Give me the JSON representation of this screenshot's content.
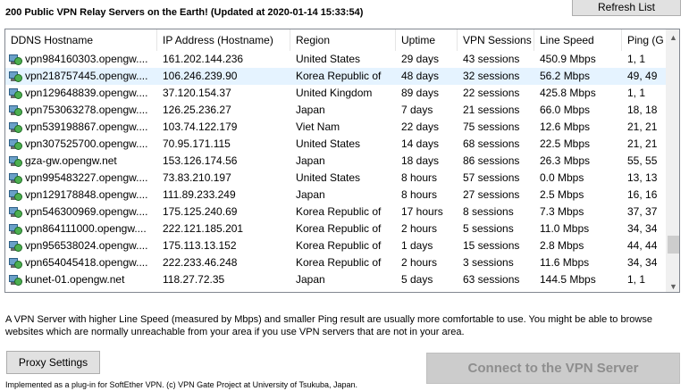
{
  "header": {
    "title": "200 Public VPN Relay Servers on the Earth! (Updated at 2020-01-14 15:33:54)",
    "refresh_label": "Refresh List"
  },
  "table": {
    "columns": [
      "DDNS Hostname",
      "IP Address (Hostname)",
      "Region",
      "Uptime",
      "VPN Sessions",
      "Line Speed",
      "Ping (G"
    ],
    "selected_row": 1,
    "rows": [
      [
        "vpn984160303.opengw....",
        "161.202.144.236",
        "United States",
        "29 days",
        "43 sessions",
        "450.9 Mbps",
        "1, 1"
      ],
      [
        "vpn218757445.opengw....",
        "106.246.239.90",
        "Korea Republic of",
        "48 days",
        "32 sessions",
        "56.2 Mbps",
        "49, 49"
      ],
      [
        "vpn129648839.opengw....",
        "37.120.154.37",
        "United Kingdom",
        "89 days",
        "22 sessions",
        "425.8 Mbps",
        "1, 1"
      ],
      [
        "vpn753063278.opengw....",
        "126.25.236.27",
        "Japan",
        "7 days",
        "21 sessions",
        "66.0 Mbps",
        "18, 18"
      ],
      [
        "vpn539198867.opengw....",
        "103.74.122.179",
        "Viet Nam",
        "22 days",
        "75 sessions",
        "12.6 Mbps",
        "21, 21"
      ],
      [
        "vpn307525700.opengw....",
        "70.95.171.115",
        "United States",
        "14 days",
        "68 sessions",
        "22.5 Mbps",
        "21, 21"
      ],
      [
        "gza-gw.opengw.net",
        "153.126.174.56",
        "Japan",
        "18 days",
        "86 sessions",
        "26.3 Mbps",
        "55, 55"
      ],
      [
        "vpn995483227.opengw....",
        "73.83.210.197",
        "United States",
        "8 hours",
        "57 sessions",
        "0.0 Mbps",
        "13, 13"
      ],
      [
        "vpn129178848.opengw....",
        "111.89.233.249",
        "Japan",
        "8 hours",
        "27 sessions",
        "2.5 Mbps",
        "16, 16"
      ],
      [
        "vpn546300969.opengw....",
        "175.125.240.69",
        "Korea Republic of",
        "17 hours",
        "8 sessions",
        "7.3 Mbps",
        "37, 37"
      ],
      [
        "vpn864111000.opengw....",
        "222.121.185.201",
        "Korea Republic of",
        "2 hours",
        "5 sessions",
        "11.0 Mbps",
        "34, 34"
      ],
      [
        "vpn956538024.opengw....",
        "175.113.13.152",
        "Korea Republic of",
        "1 days",
        "15 sessions",
        "2.8 Mbps",
        "44, 44"
      ],
      [
        "vpn654045418.opengw....",
        "222.233.46.248",
        "Korea Republic of",
        "2 hours",
        "3 sessions",
        "11.6 Mbps",
        "34, 34"
      ],
      [
        "kunet-01.opengw.net",
        "118.27.72.35",
        "Japan",
        "5 days",
        "63 sessions",
        "144.5 Mbps",
        "1, 1"
      ]
    ]
  },
  "scrollbar": {
    "up": "▲",
    "down": "▼"
  },
  "description": "A VPN Server with higher Line Speed (measured by Mbps) and smaller Ping result are usually more comfortable to use. You might be able to browse websites which are normally unreachable from your area if you use VPN servers that are not in your area.",
  "buttons": {
    "proxy_label": "Proxy Settings",
    "connect_label": "Connect to the VPN Server"
  },
  "footer": "Implemented as a plug-in for SoftEther VPN. (c) VPN Gate Project at University of Tsukuba, Japan."
}
